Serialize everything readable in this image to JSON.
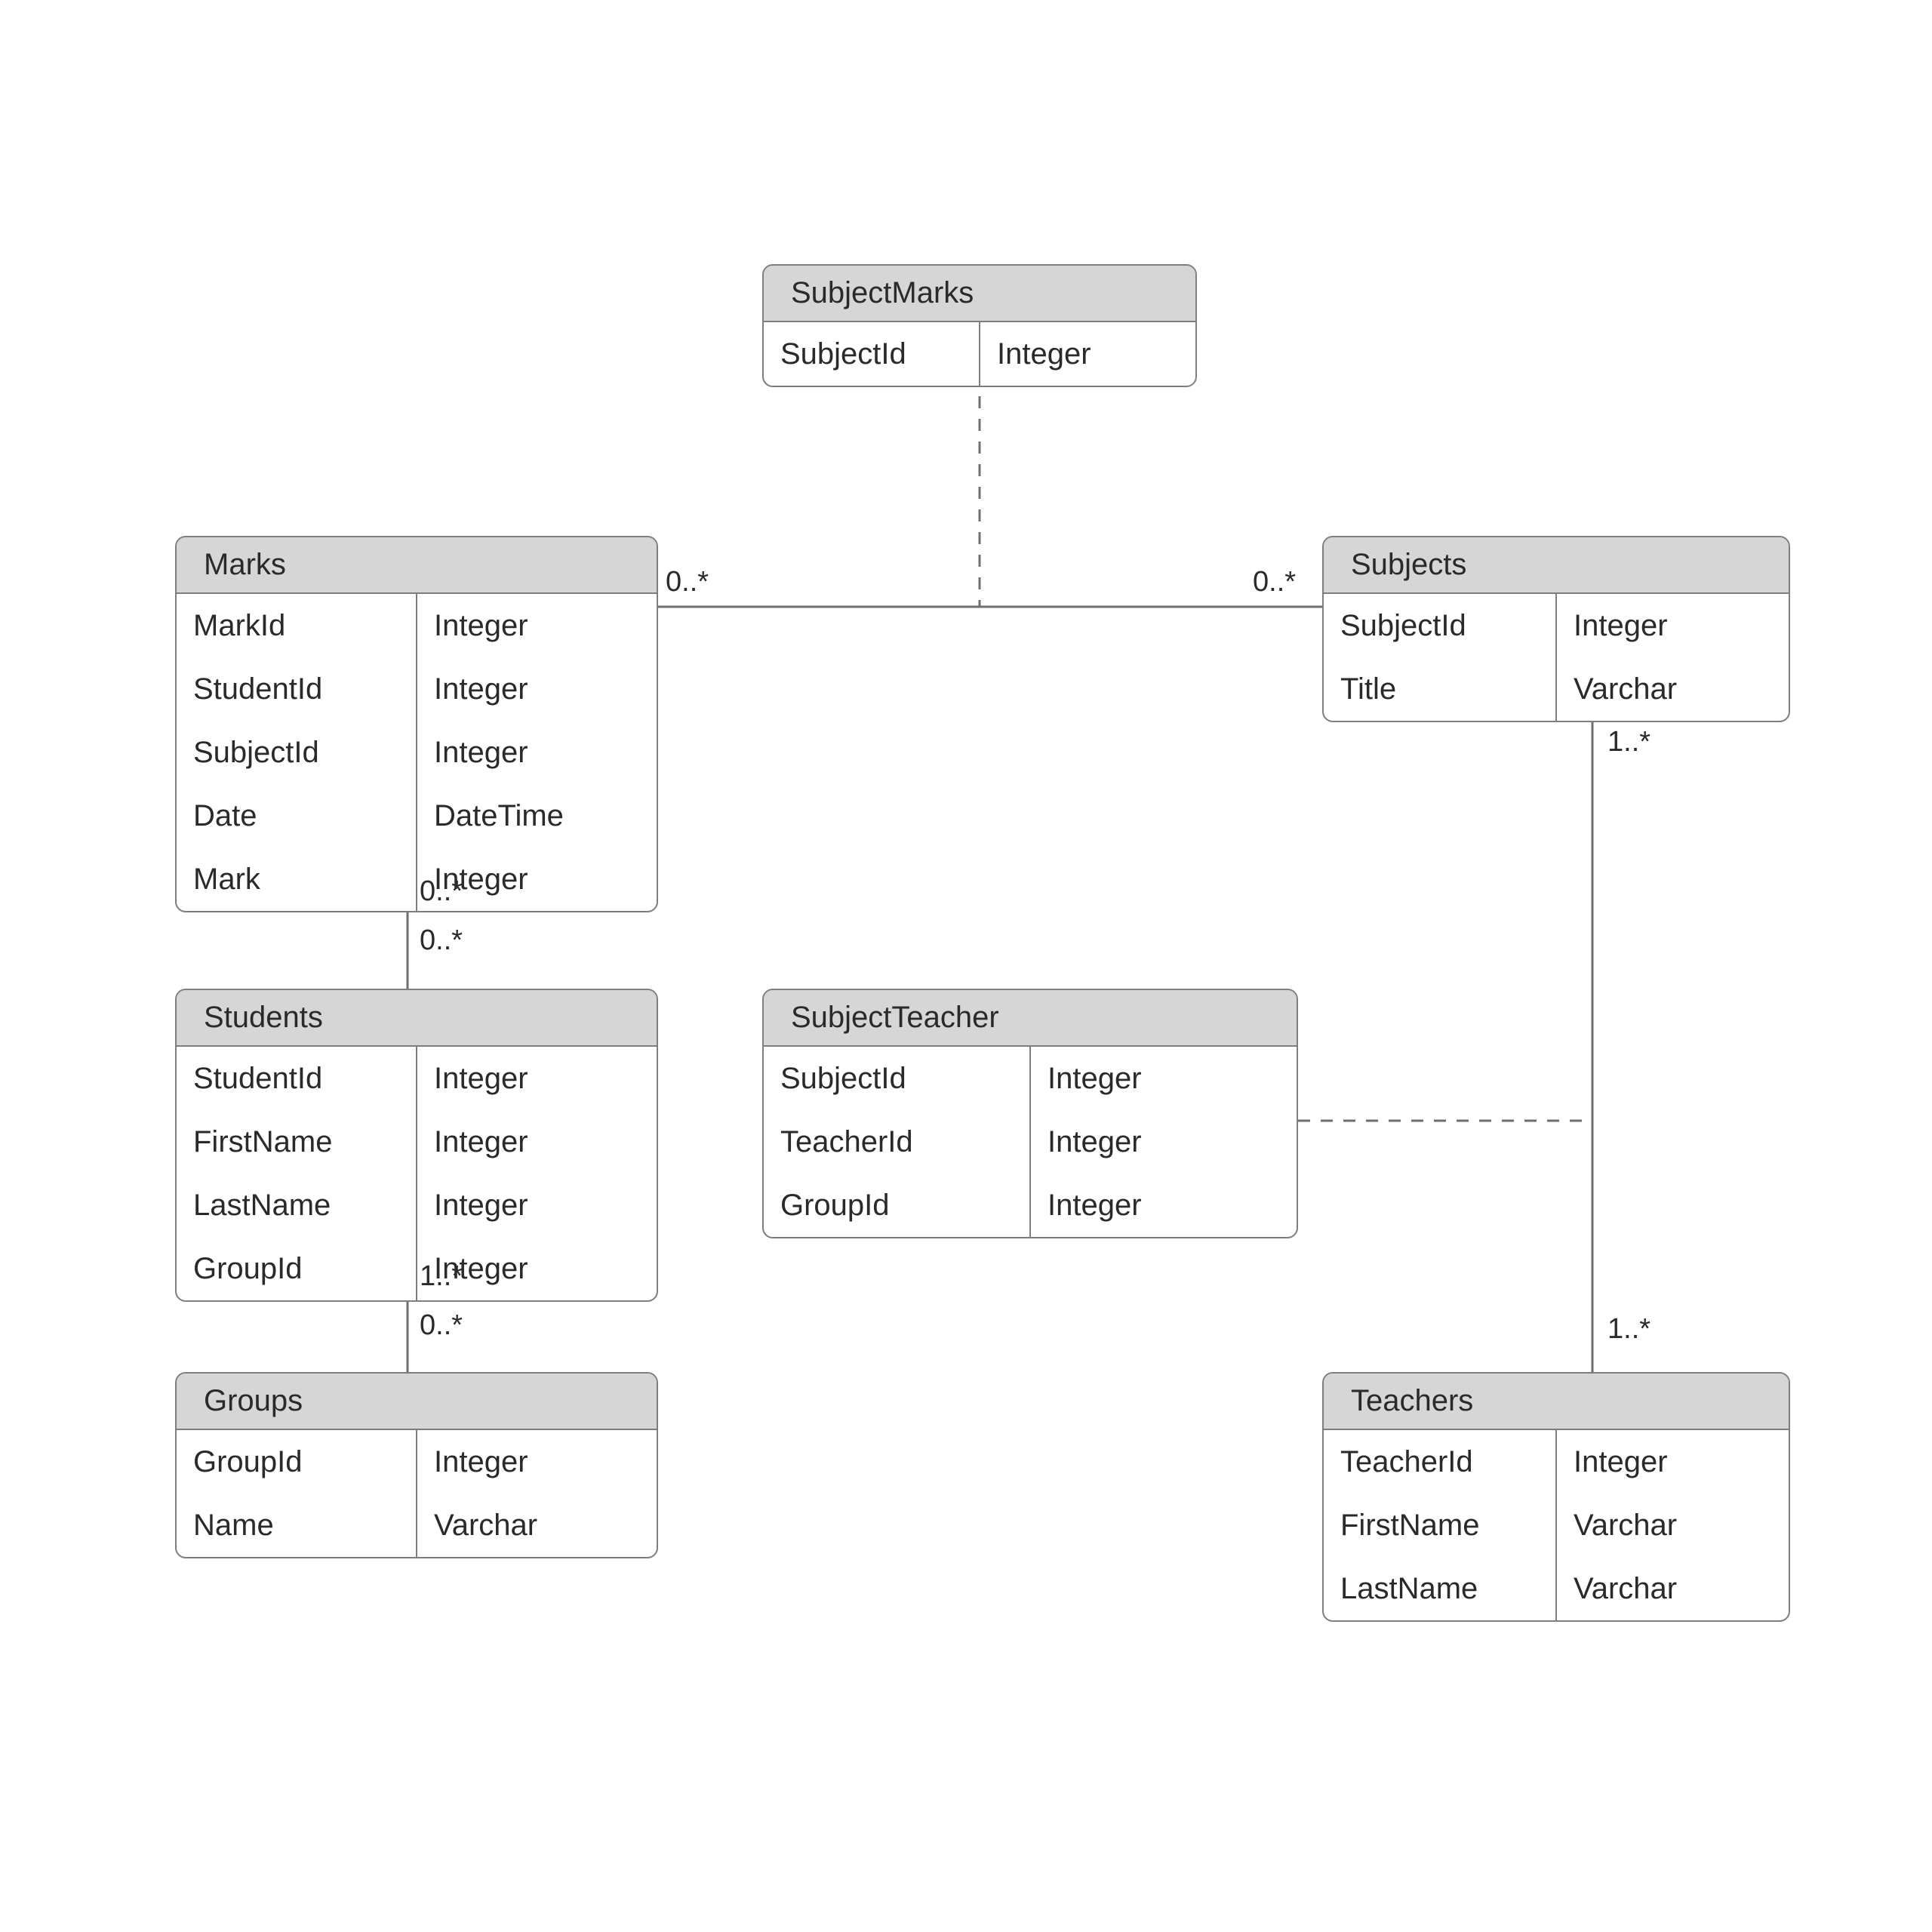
{
  "entities": {
    "subjectMarks": {
      "title": "SubjectMarks",
      "fields": [
        {
          "name": "SubjectId",
          "type": "Integer"
        }
      ]
    },
    "marks": {
      "title": "Marks",
      "fields": [
        {
          "name": "MarkId",
          "type": "Integer"
        },
        {
          "name": "StudentId",
          "type": "Integer"
        },
        {
          "name": "SubjectId",
          "type": "Integer"
        },
        {
          "name": "Date",
          "type": "DateTime"
        },
        {
          "name": "Mark",
          "type": "Integer"
        }
      ]
    },
    "subjects": {
      "title": "Subjects",
      "fields": [
        {
          "name": "SubjectId",
          "type": "Integer"
        },
        {
          "name": "Title",
          "type": "Varchar"
        }
      ]
    },
    "students": {
      "title": "Students",
      "fields": [
        {
          "name": "StudentId",
          "type": "Integer"
        },
        {
          "name": "FirstName",
          "type": "Integer"
        },
        {
          "name": "LastName",
          "type": "Integer"
        },
        {
          "name": "GroupId",
          "type": "Integer"
        }
      ]
    },
    "subjectTeacher": {
      "title": "SubjectTeacher",
      "fields": [
        {
          "name": "SubjectId",
          "type": "Integer"
        },
        {
          "name": "TeacherId",
          "type": "Integer"
        },
        {
          "name": "GroupId",
          "type": "Integer"
        }
      ]
    },
    "groups": {
      "title": "Groups",
      "fields": [
        {
          "name": "GroupId",
          "type": "Integer"
        },
        {
          "name": "Name",
          "type": "Varchar"
        }
      ]
    },
    "teachers": {
      "title": "Teachers",
      "fields": [
        {
          "name": "TeacherId",
          "type": "Integer"
        },
        {
          "name": "FirstName",
          "type": "Varchar"
        },
        {
          "name": "LastName",
          "type": "Varchar"
        }
      ]
    }
  },
  "multiplicities": {
    "marks_subjects_left": "0..*",
    "marks_subjects_right": "0..*",
    "marks_students_top": "0..*",
    "marks_students_bot": "0..*",
    "students_groups_top": "1..*",
    "students_groups_bot": "0..*",
    "subjects_teachers_top": "1..*",
    "subjects_teachers_bot": "1..*"
  }
}
